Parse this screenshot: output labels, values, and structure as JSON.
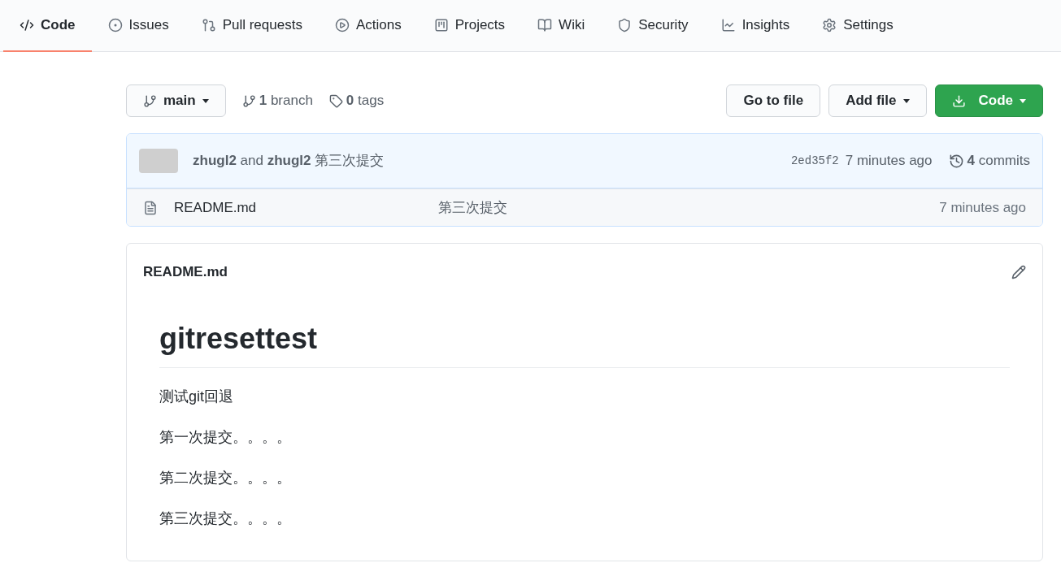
{
  "tabs": [
    {
      "label": "Code",
      "selected": true
    },
    {
      "label": "Issues",
      "selected": false
    },
    {
      "label": "Pull requests",
      "selected": false
    },
    {
      "label": "Actions",
      "selected": false
    },
    {
      "label": "Projects",
      "selected": false
    },
    {
      "label": "Wiki",
      "selected": false
    },
    {
      "label": "Security",
      "selected": false
    },
    {
      "label": "Insights",
      "selected": false
    },
    {
      "label": "Settings",
      "selected": false
    }
  ],
  "branch_button": {
    "label": "main"
  },
  "branches": "**1** branch",
  "tags": "**0** tags",
  "actions": [
    {
      "label": "Go to file",
      "kind": "plain"
    },
    {
      "label": "Add file",
      "kind": "menu"
    },
    {
      "label": "Code",
      "kind": "primary"
    }
  ],
  "latest_commit": {
    "message": "**zhugl2** and **zhugl2** 第三次提交",
    "sha": "2ed35f2",
    "time": "7 minutes ago",
    "commits": "**4** commits"
  },
  "files": [
    {
      "name": "README.md",
      "message": "第三次提交",
      "time": "7 minutes ago"
    }
  ],
  "readme": {
    "filename": "README.md",
    "heading": "gitresettest",
    "paragraphs": [
      "测试git回退",
      "第一次提交。。。。",
      "第二次提交。。。。",
      "第三次提交。。。。"
    ]
  }
}
